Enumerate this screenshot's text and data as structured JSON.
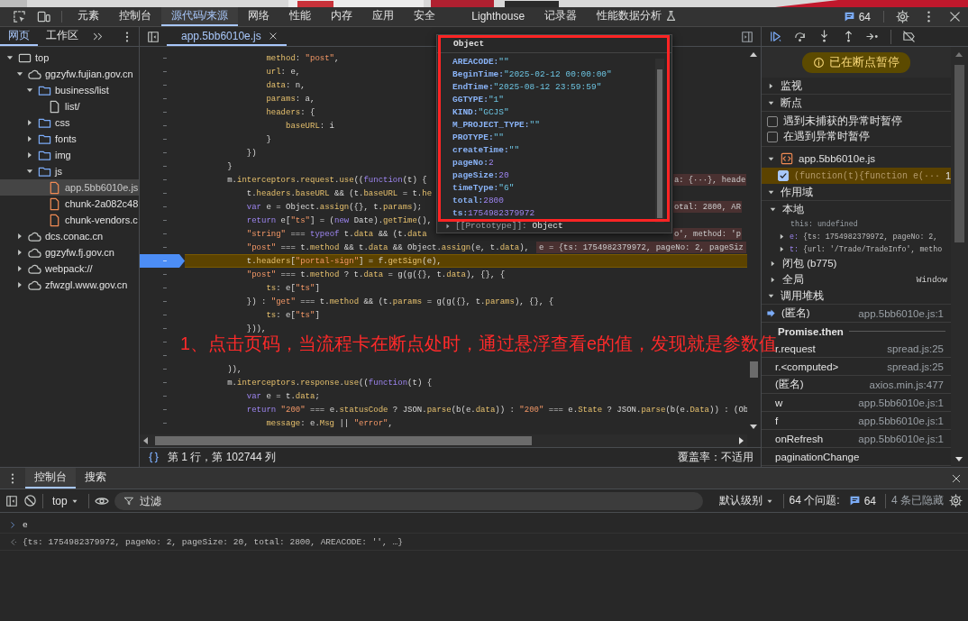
{
  "toolbar": {
    "tabs": [
      {
        "label": "元素",
        "kind": "panel",
        "selected": false
      },
      {
        "label": "控制台",
        "kind": "panel",
        "selected": false
      },
      {
        "label": "源代码/来源",
        "kind": "panel",
        "selected": true
      },
      {
        "label": "网络",
        "kind": "panel",
        "selected": false
      },
      {
        "label": "性能",
        "kind": "panel",
        "selected": false
      },
      {
        "label": "内存",
        "kind": "panel",
        "selected": false
      },
      {
        "label": "应用",
        "kind": "panel",
        "selected": false
      },
      {
        "label": "安全",
        "kind": "panel",
        "selected": false
      },
      {
        "label": "Lighthouse",
        "kind": "panel",
        "selected": false
      },
      {
        "label": "记录器",
        "kind": "panel",
        "selected": false
      },
      {
        "label": "性能数据分析",
        "kind": "experiment",
        "selected": false
      }
    ],
    "issues": "64"
  },
  "navigator": {
    "tabs": [
      {
        "label": "网页",
        "selected": true
      },
      {
        "label": "工作区",
        "selected": false
      }
    ],
    "tree": [
      {
        "label": "top",
        "kind": "frame",
        "expanded": true,
        "selected": false,
        "children": [
          {
            "label": "ggzyfw.fujian.gov.cn",
            "kind": "domain",
            "expanded": true,
            "selected": false,
            "children": [
              {
                "label": "business/list",
                "kind": "folder",
                "expanded": true,
                "selected": false,
                "children": [
                  {
                    "label": "list/",
                    "kind": "document",
                    "selected": false
                  }
                ]
              },
              {
                "label": "css",
                "kind": "folder",
                "expanded": false,
                "selected": false
              },
              {
                "label": "fonts",
                "kind": "folder",
                "expanded": false,
                "selected": false
              },
              {
                "label": "img",
                "kind": "folder",
                "expanded": false,
                "selected": false
              },
              {
                "label": "js",
                "kind": "folder",
                "expanded": true,
                "selected": false,
                "children": [
                  {
                    "label": "app.5bb6010e.js",
                    "kind": "script",
                    "selected": true
                  },
                  {
                    "label": "chunk-2a082c48",
                    "kind": "script",
                    "selected": false
                  },
                  {
                    "label": "chunk-vendors.c",
                    "kind": "script",
                    "selected": false
                  }
                ]
              }
            ]
          },
          {
            "label": "dcs.conac.cn",
            "kind": "domain",
            "expanded": false,
            "selected": false
          },
          {
            "label": "ggzyfw.fj.gov.cn",
            "kind": "domain",
            "expanded": false,
            "selected": false
          },
          {
            "label": "webpack://",
            "kind": "domain",
            "expanded": false,
            "selected": false
          },
          {
            "label": "zfwzgl.www.gov.cn",
            "kind": "domain",
            "expanded": false,
            "selected": false
          }
        ]
      }
    ]
  },
  "editor": {
    "tab": {
      "label": "app.5bb6010e.js",
      "selected": true
    },
    "lines": [
      {
        "gutter": "–",
        "paused": false,
        "segments": [
          {
            "text": "                method",
            "kind": "prop"
          },
          {
            "text": ": ",
            "kind": "plain"
          },
          {
            "text": "\"post\"",
            "kind": "str"
          },
          {
            "text": ",",
            "kind": "plain"
          }
        ]
      },
      {
        "gutter": "–",
        "paused": false,
        "segments": [
          {
            "text": "                url",
            "kind": "prop"
          },
          {
            "text": ": e,",
            "kind": "plain"
          }
        ]
      },
      {
        "gutter": "–",
        "paused": false,
        "segments": [
          {
            "text": "                data",
            "kind": "prop"
          },
          {
            "text": ": n,",
            "kind": "plain"
          }
        ]
      },
      {
        "gutter": "–",
        "paused": false,
        "segments": [
          {
            "text": "                params",
            "kind": "prop"
          },
          {
            "text": ": a,",
            "kind": "plain"
          }
        ]
      },
      {
        "gutter": "–",
        "paused": false,
        "segments": [
          {
            "text": "                headers",
            "kind": "prop"
          },
          {
            "text": ": {",
            "kind": "plain"
          }
        ]
      },
      {
        "gutter": "–",
        "paused": false,
        "segments": [
          {
            "text": "                    baseURL",
            "kind": "prop"
          },
          {
            "text": ": i",
            "kind": "plain"
          }
        ]
      },
      {
        "gutter": "–",
        "paused": false,
        "segments": [
          {
            "text": "                }",
            "kind": "plain"
          }
        ]
      },
      {
        "gutter": "–",
        "paused": false,
        "segments": [
          {
            "text": "            })",
            "kind": "plain"
          }
        ]
      },
      {
        "gutter": "–",
        "paused": false,
        "segments": [
          {
            "text": "        }",
            "kind": "plain"
          }
        ]
      },
      {
        "gutter": "–",
        "paused": false,
        "segments": [
          {
            "text": "        m.",
            "kind": "plain"
          },
          {
            "text": "interceptors",
            "kind": "prop"
          },
          {
            "text": ".",
            "kind": "plain"
          },
          {
            "text": "request",
            "kind": "prop"
          },
          {
            "text": ".",
            "kind": "plain"
          },
          {
            "text": "use",
            "kind": "prop"
          },
          {
            "text": "((",
            "kind": "plain"
          },
          {
            "text": "function",
            "kind": "kw"
          },
          {
            "text": "(t) {",
            "kind": "plain"
          }
        ],
        "hint_tail": "a: {···}, heade"
      },
      {
        "gutter": "–",
        "paused": false,
        "segments": [
          {
            "text": "            t.",
            "kind": "plain"
          },
          {
            "text": "headers",
            "kind": "prop"
          },
          {
            "text": ".",
            "kind": "plain"
          },
          {
            "text": "baseURL",
            "kind": "prop"
          },
          {
            "text": " && (t.",
            "kind": "plain"
          },
          {
            "text": "baseURL",
            "kind": "prop"
          },
          {
            "text": " = t.",
            "kind": "plain"
          },
          {
            "text": "he",
            "kind": "prop"
          }
        ]
      },
      {
        "gutter": "–",
        "paused": false,
        "segments": [
          {
            "text": "            var",
            "kind": "kw"
          },
          {
            "text": " e = Object.",
            "kind": "plain"
          },
          {
            "text": "assign",
            "kind": "prop"
          },
          {
            "text": "({}, t.",
            "kind": "plain"
          },
          {
            "text": "params",
            "kind": "prop"
          },
          {
            "text": ");",
            "kind": "plain"
          }
        ],
        "hint_tail": "otal: 2800, AR"
      },
      {
        "gutter": "–",
        "paused": false,
        "segments": [
          {
            "text": "            return",
            "kind": "kw"
          },
          {
            "text": " e[",
            "kind": "plain"
          },
          {
            "text": "\"ts\"",
            "kind": "str"
          },
          {
            "text": "] = (",
            "kind": "plain"
          },
          {
            "text": "new",
            "kind": "kw"
          },
          {
            "text": " Date).",
            "kind": "plain"
          },
          {
            "text": "getTime",
            "kind": "prop"
          },
          {
            "text": "(),",
            "kind": "plain"
          }
        ]
      },
      {
        "gutter": "–",
        "paused": false,
        "segments": [
          {
            "text": "            \"string\"",
            "kind": "str"
          },
          {
            "text": " === ",
            "kind": "plain"
          },
          {
            "text": "typeof",
            "kind": "kw"
          },
          {
            "text": " t.",
            "kind": "plain"
          },
          {
            "text": "data",
            "kind": "prop"
          },
          {
            "text": " && (t.",
            "kind": "plain"
          },
          {
            "text": "data",
            "kind": "prop"
          }
        ],
        "hint_tail": "o', method: 'p"
      },
      {
        "gutter": "–",
        "paused": false,
        "segments": [
          {
            "text": "            \"post\"",
            "kind": "str"
          },
          {
            "text": " === t.",
            "kind": "plain"
          },
          {
            "text": "method",
            "kind": "prop"
          },
          {
            "text": " && t.",
            "kind": "plain"
          },
          {
            "text": "data",
            "kind": "prop"
          },
          {
            "text": " && Object.",
            "kind": "plain"
          },
          {
            "text": "assign",
            "kind": "prop"
          },
          {
            "text": "(e, t.",
            "kind": "plain"
          },
          {
            "text": "data",
            "kind": "prop"
          },
          {
            "text": "),",
            "kind": "plain"
          }
        ],
        "hint": "e = {ts: 1754982379972, pageNo: 2, pageSiz"
      },
      {
        "gutter": "–",
        "paused": true,
        "segments": [
          {
            "text": "            t.",
            "kind": "plain"
          },
          {
            "text": "headers",
            "kind": "prop"
          },
          {
            "text": "[",
            "kind": "plain"
          },
          {
            "text": "\"portal-sign\"",
            "kind": "str"
          },
          {
            "text": "] = f.",
            "kind": "plain"
          },
          {
            "text": "getSign",
            "kind": "prop"
          },
          {
            "text": "(e),",
            "kind": "plain"
          }
        ]
      },
      {
        "gutter": "–",
        "paused": false,
        "segments": [
          {
            "text": "            \"post\"",
            "kind": "str"
          },
          {
            "text": " === t.",
            "kind": "plain"
          },
          {
            "text": "method",
            "kind": "prop"
          },
          {
            "text": " ? t.",
            "kind": "plain"
          },
          {
            "text": "data",
            "kind": "prop"
          },
          {
            "text": " = g(g({}, t.",
            "kind": "plain"
          },
          {
            "text": "data",
            "kind": "prop"
          },
          {
            "text": "), {}, {",
            "kind": "plain"
          }
        ]
      },
      {
        "gutter": "–",
        "paused": false,
        "segments": [
          {
            "text": "                ts",
            "kind": "prop"
          },
          {
            "text": ": e[",
            "kind": "plain"
          },
          {
            "text": "\"ts\"",
            "kind": "str"
          },
          {
            "text": "]",
            "kind": "plain"
          }
        ]
      },
      {
        "gutter": "–",
        "paused": false,
        "segments": [
          {
            "text": "            }) : ",
            "kind": "plain"
          },
          {
            "text": "\"get\"",
            "kind": "str"
          },
          {
            "text": " === t.",
            "kind": "plain"
          },
          {
            "text": "method",
            "kind": "prop"
          },
          {
            "text": " && (t.",
            "kind": "plain"
          },
          {
            "text": "params",
            "kind": "prop"
          },
          {
            "text": " = g(g({}, t.",
            "kind": "plain"
          },
          {
            "text": "params",
            "kind": "prop"
          },
          {
            "text": "), {}, {",
            "kind": "plain"
          }
        ]
      },
      {
        "gutter": "–",
        "paused": false,
        "segments": [
          {
            "text": "                ts",
            "kind": "prop"
          },
          {
            "text": ": e[",
            "kind": "plain"
          },
          {
            "text": "\"ts\"",
            "kind": "str"
          },
          {
            "text": "]",
            "kind": "plain"
          }
        ]
      },
      {
        "gutter": "–",
        "paused": false,
        "segments": [
          {
            "text": "            })),",
            "kind": "plain"
          }
        ]
      },
      {
        "gutter": "–",
        "paused": false
      },
      {
        "gutter": "–",
        "paused": false
      },
      {
        "gutter": "–",
        "paused": false,
        "segments": [
          {
            "text": "        )),",
            "kind": "plain"
          }
        ]
      },
      {
        "gutter": "–",
        "paused": false,
        "segments": [
          {
            "text": "        m.",
            "kind": "plain"
          },
          {
            "text": "interceptors",
            "kind": "prop"
          },
          {
            "text": ".",
            "kind": "plain"
          },
          {
            "text": "response",
            "kind": "prop"
          },
          {
            "text": ".",
            "kind": "plain"
          },
          {
            "text": "use",
            "kind": "prop"
          },
          {
            "text": "((",
            "kind": "plain"
          },
          {
            "text": "function",
            "kind": "kw"
          },
          {
            "text": "(t) {",
            "kind": "plain"
          }
        ]
      },
      {
        "gutter": "–",
        "paused": false,
        "segments": [
          {
            "text": "            var",
            "kind": "kw"
          },
          {
            "text": " e = t.",
            "kind": "plain"
          },
          {
            "text": "data",
            "kind": "prop"
          },
          {
            "text": ";",
            "kind": "plain"
          }
        ]
      },
      {
        "gutter": "–",
        "paused": false,
        "segments": [
          {
            "text": "            return ",
            "kind": "kw"
          },
          {
            "text": "\"200\"",
            "kind": "str"
          },
          {
            "text": " === e.",
            "kind": "plain"
          },
          {
            "text": "statusCode",
            "kind": "prop"
          },
          {
            "text": " ? JSON.",
            "kind": "plain"
          },
          {
            "text": "parse",
            "kind": "prop"
          },
          {
            "text": "(b(e.",
            "kind": "plain"
          },
          {
            "text": "data",
            "kind": "prop"
          },
          {
            "text": ")) : ",
            "kind": "plain"
          },
          {
            "text": "\"200\"",
            "kind": "str"
          },
          {
            "text": " === e.",
            "kind": "plain"
          },
          {
            "text": "State",
            "kind": "prop"
          },
          {
            "text": " ? JSON.",
            "kind": "plain"
          },
          {
            "text": "parse",
            "kind": "prop"
          },
          {
            "text": "(b(e.",
            "kind": "plain"
          },
          {
            "text": "Data",
            "kind": "prop"
          },
          {
            "text": ")) : (Ob",
            "kind": "plain"
          }
        ]
      },
      {
        "gutter": "–",
        "paused": false,
        "segments": [
          {
            "text": "                message",
            "kind": "prop"
          },
          {
            "text": ": e.",
            "kind": "plain"
          },
          {
            "text": "Msg",
            "kind": "prop"
          },
          {
            "text": " || ",
            "kind": "plain"
          },
          {
            "text": "\"error\"",
            "kind": "str"
          },
          {
            "text": ",",
            "kind": "plain"
          }
        ]
      }
    ],
    "status": {
      "position": "第 1 行，第 102744 列",
      "coverage": "覆盖率：不适用"
    }
  },
  "popup": {
    "title": "Object",
    "properties": [
      {
        "name": "AREACODE:",
        "value": "\"\"",
        "kind": "string"
      },
      {
        "name": "BeginTime:",
        "value": "\"2025-02-12 00:00:00\"",
        "kind": "string"
      },
      {
        "name": "EndTime:",
        "value": "\"2025-08-12 23:59:59\"",
        "kind": "string"
      },
      {
        "name": "GGTYPE:",
        "value": "\"1\"",
        "kind": "string"
      },
      {
        "name": "KIND:",
        "value": "\"GCJS\"",
        "kind": "string"
      },
      {
        "name": "M_PROJECT_TYPE:",
        "value": "\"\"",
        "kind": "string"
      },
      {
        "name": "PROTYPE:",
        "value": "\"\"",
        "kind": "string"
      },
      {
        "name": "createTime:",
        "value": "\"\"",
        "kind": "string"
      },
      {
        "name": "pageNo:",
        "value": "2",
        "kind": "number"
      },
      {
        "name": "pageSize:",
        "value": "20",
        "kind": "number"
      },
      {
        "name": "timeType:",
        "value": "\"6\"",
        "kind": "string"
      },
      {
        "name": "total:",
        "value": "2800",
        "kind": "number"
      },
      {
        "name": "ts:",
        "value": "1754982379972",
        "kind": "number"
      }
    ],
    "prototype": {
      "name": "[[Prototype]]:",
      "value": "Object"
    }
  },
  "debugger": {
    "banner": "已在断点暂停",
    "sections": [
      {
        "title": "监视",
        "expanded": false
      },
      {
        "kind": "breakpoints",
        "title": "断点",
        "expanded": true,
        "options": [
          {
            "label": "遇到未捕获的异常时暂停",
            "checked": false
          },
          {
            "label": "在遇到异常时暂停",
            "checked": false
          }
        ],
        "files": [
          {
            "name": "app.5bb6010e.js",
            "breakpoints": [
              {
                "code": "(function(t){function e(···",
                "line": "1",
                "checked": true
              }
            ]
          }
        ]
      },
      {
        "kind": "scope",
        "title": "作用域",
        "expanded": true,
        "scopes": [
          {
            "name": "本地",
            "expanded": true,
            "vars": [
              {
                "name": "this:",
                "value": "undefined",
                "expandable": false
              },
              {
                "name": "e:",
                "value": "{ts: 1754982379972, pageNo: 2,",
                "expandable": true
              },
              {
                "name": "t:",
                "value": "{url: '/Trade/TradeInfo', metho",
                "expandable": true
              }
            ]
          },
          {
            "name": "闭包 (b775)",
            "expanded": false
          },
          {
            "name": "全局",
            "value": "Window",
            "expanded": false
          }
        ]
      },
      {
        "kind": "callstack",
        "title": "调用堆栈",
        "expanded": true,
        "frames": [
          {
            "kind": "frame",
            "name": "(匿名)",
            "location": "app.5bb6010e.js:1",
            "current": true
          },
          {
            "kind": "async",
            "name": "Promise.then"
          },
          {
            "kind": "frame",
            "name": "r.request",
            "location": "spread.js:25",
            "current": false
          },
          {
            "kind": "frame",
            "name": "r.<computed>",
            "location": "spread.js:25",
            "current": false
          },
          {
            "kind": "frame",
            "name": "(匿名)",
            "location": "axios.min.js:477",
            "current": false
          },
          {
            "kind": "frame",
            "name": "w",
            "location": "app.5bb6010e.js:1",
            "current": false
          },
          {
            "kind": "frame",
            "name": "f",
            "location": "app.5bb6010e.js:1",
            "current": false
          },
          {
            "kind": "frame",
            "name": "onRefresh",
            "location": "app.5bb6010e.js:1",
            "current": false
          },
          {
            "kind": "frame",
            "name": "paginationChange",
            "current": false
          }
        ]
      }
    ]
  },
  "drawer": {
    "tabs": [
      {
        "label": "控制台",
        "selected": true
      },
      {
        "label": "搜索",
        "selected": false
      }
    ],
    "context": "top",
    "filter_placeholder": "过滤",
    "level": "默认级别",
    "issues_label": "64 个问题:",
    "issues_count": "64",
    "hidden": "4 条已隐藏",
    "messages": [
      {
        "kind": "input",
        "text": "e"
      },
      {
        "kind": "result",
        "text": "{ts: 1754982379972, pageNo: 2, pageSize: 20, total: 2800, AREACODE: '', …}"
      }
    ]
  },
  "annotation": "1、点击页码，当流程卡在断点处时，通过悬浮查看e的值，发现就是参数值"
}
